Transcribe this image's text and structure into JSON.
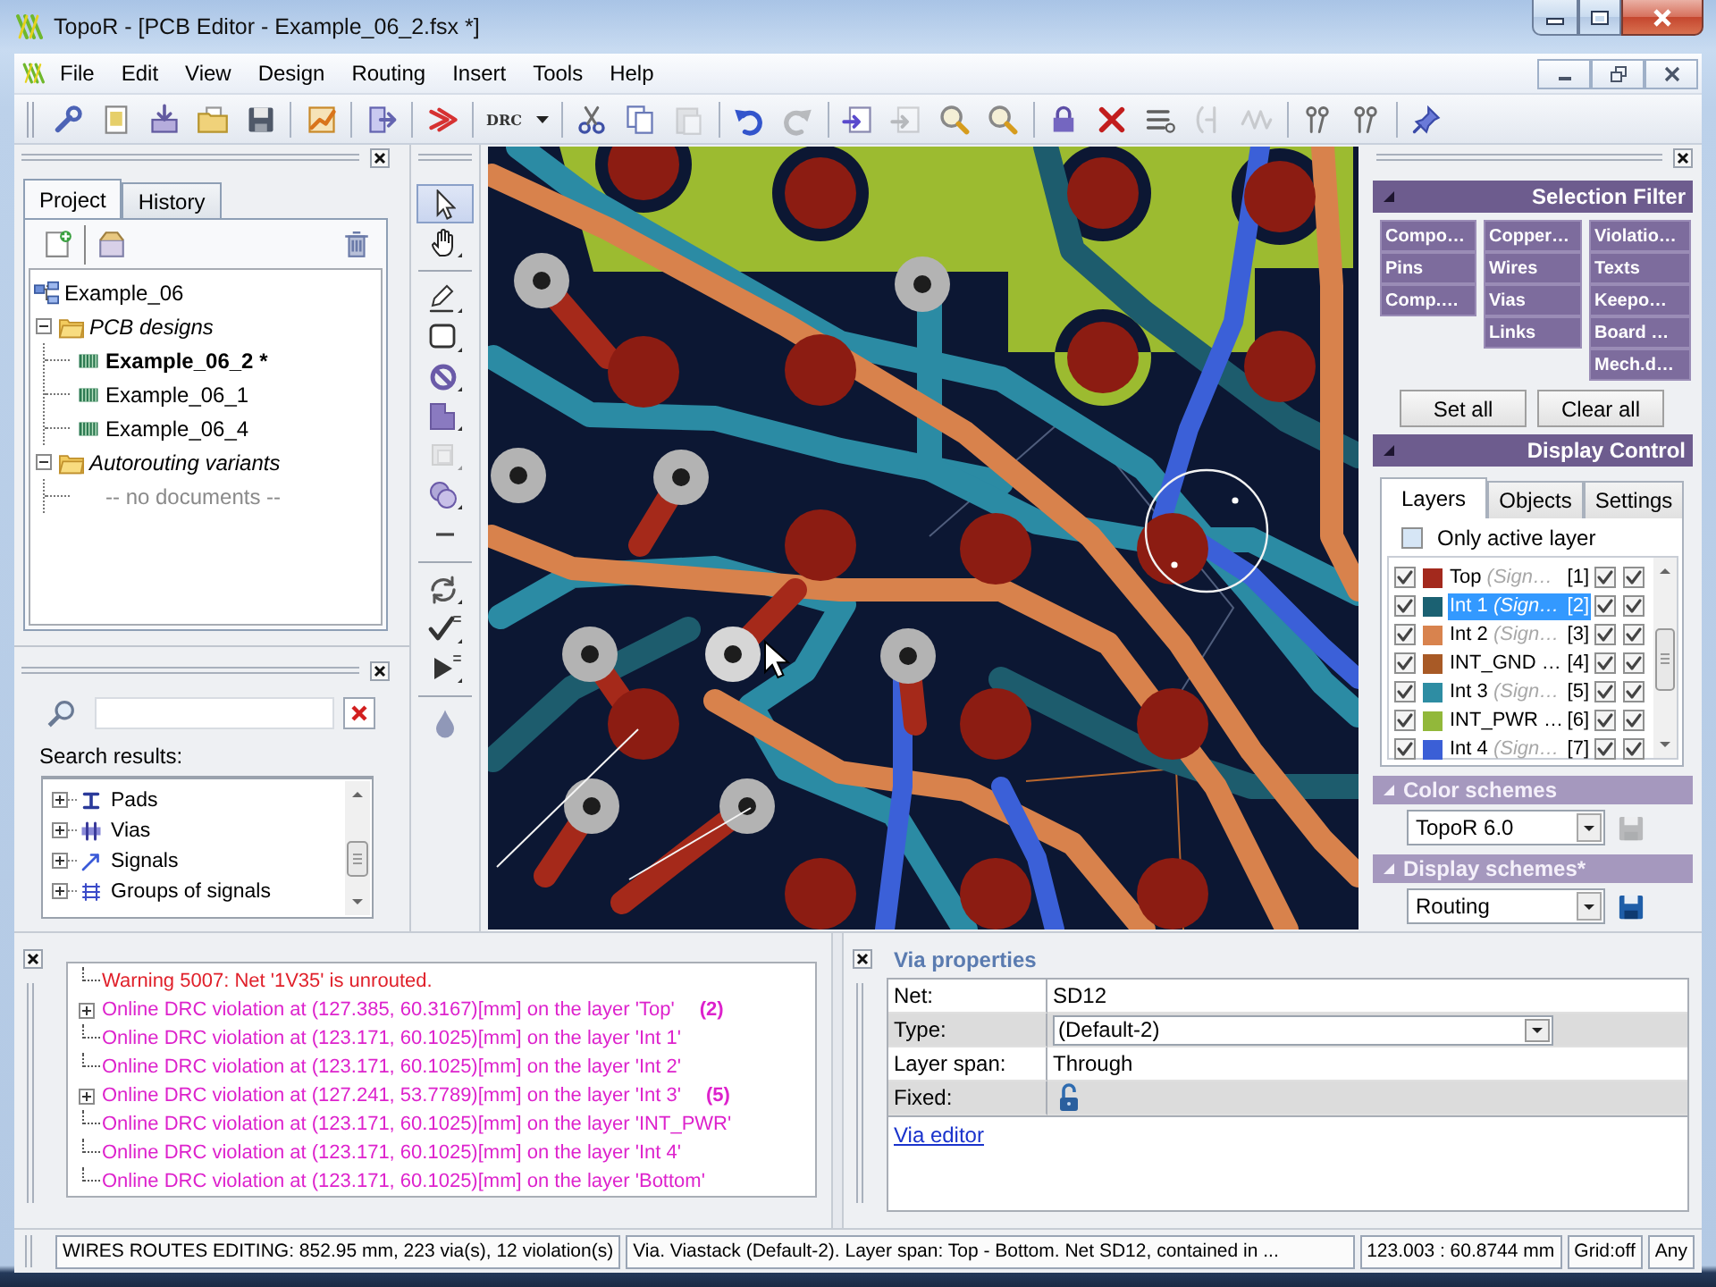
{
  "window": {
    "title": "TopoR - [PCB Editor - Example_06_2.fsx *]"
  },
  "menu": [
    "File",
    "Edit",
    "View",
    "Design",
    "Routing",
    "Insert",
    "Tools",
    "Help"
  ],
  "toolbar": [
    {
      "kind": "icon",
      "disabled": false
    },
    {
      "kind": "icon",
      "disabled": false
    },
    {
      "kind": "icon",
      "disabled": false
    },
    {
      "kind": "icon",
      "disabled": false
    },
    {
      "kind": "icon",
      "disabled": false
    },
    {
      "kind": "separator"
    },
    {
      "kind": "icon",
      "disabled": false
    },
    {
      "kind": "separator"
    },
    {
      "kind": "icon",
      "disabled": false
    },
    {
      "kind": "separator"
    },
    {
      "kind": "icon",
      "disabled": false
    },
    {
      "kind": "separator"
    },
    {
      "kind": "dropdown",
      "label": "DRC"
    },
    {
      "kind": "separator"
    },
    {
      "kind": "icon",
      "disabled": false
    },
    {
      "kind": "icon",
      "disabled": false
    },
    {
      "kind": "icon",
      "disabled": true
    },
    {
      "kind": "separator"
    },
    {
      "kind": "icon",
      "disabled": false
    },
    {
      "kind": "icon",
      "disabled": true
    },
    {
      "kind": "separator"
    },
    {
      "kind": "icon",
      "disabled": false
    },
    {
      "kind": "icon",
      "disabled": true
    },
    {
      "kind": "icon",
      "disabled": false
    },
    {
      "kind": "icon",
      "disabled": false
    },
    {
      "kind": "separator"
    },
    {
      "kind": "icon",
      "disabled": false
    },
    {
      "kind": "icon",
      "disabled": false
    },
    {
      "kind": "icon",
      "disabled": false
    },
    {
      "kind": "icon",
      "disabled": true
    },
    {
      "kind": "icon",
      "disabled": true
    },
    {
      "kind": "separator"
    },
    {
      "kind": "icon",
      "disabled": false
    },
    {
      "kind": "icon",
      "disabled": false
    },
    {
      "kind": "separator"
    },
    {
      "kind": "icon",
      "disabled": false
    }
  ],
  "project_panel": {
    "tabs": [
      {
        "label": "Project",
        "selected": true
      },
      {
        "label": "History",
        "selected": false
      }
    ],
    "tree": [
      {
        "label": "Example_06",
        "kind": "project",
        "children": [
          {
            "label": "PCB designs",
            "kind": "folder",
            "expanded": true,
            "children": [
              {
                "label": "Example_06_2 *",
                "kind": "design",
                "active": true
              },
              {
                "label": "Example_06_1",
                "kind": "design",
                "active": false
              },
              {
                "label": "Example_06_4",
                "kind": "design",
                "active": false
              }
            ]
          },
          {
            "label": "Autorouting variants",
            "kind": "folder",
            "expanded": true,
            "children": [
              {
                "label": "-- no documents --",
                "kind": "empty"
              }
            ]
          }
        ]
      }
    ]
  },
  "search_panel": {
    "results_label": "Search results:",
    "results": [
      {
        "label": "Pads",
        "expanded": false
      },
      {
        "label": "Vias",
        "expanded": false
      },
      {
        "label": "Signals",
        "expanded": false
      },
      {
        "label": "Groups of signals",
        "expanded": false
      }
    ]
  },
  "tool_strip": [
    {
      "kind": "tool",
      "selected": true,
      "disabled": false
    },
    {
      "kind": "tool",
      "selected": false,
      "disabled": false
    },
    {
      "kind": "separator"
    },
    {
      "kind": "tool",
      "selected": false,
      "disabled": false
    },
    {
      "kind": "tool",
      "selected": false,
      "disabled": false
    },
    {
      "kind": "tool",
      "selected": false,
      "disabled": false
    },
    {
      "kind": "tool",
      "selected": false,
      "disabled": false
    },
    {
      "kind": "tool",
      "selected": false,
      "disabled": true
    },
    {
      "kind": "tool",
      "selected": false,
      "disabled": false
    },
    {
      "kind": "tool",
      "selected": false,
      "disabled": false
    },
    {
      "kind": "separator"
    },
    {
      "kind": "tool",
      "selected": false,
      "disabled": false
    },
    {
      "kind": "tool",
      "selected": false,
      "disabled": false
    },
    {
      "kind": "tool",
      "selected": false,
      "disabled": false
    },
    {
      "kind": "separator"
    },
    {
      "kind": "tool",
      "selected": false,
      "disabled": false
    }
  ],
  "selection_filter": {
    "title": "Selection Filter",
    "columns": [
      [
        "Compo…",
        "Pins",
        "Comp.…"
      ],
      [
        "Copper…",
        "Wires",
        "Vias",
        "Links"
      ],
      [
        "Violatio…",
        "Texts",
        "Keepo…",
        "Board …",
        "Mech.d…"
      ]
    ],
    "buttons": [
      "Set all",
      "Clear all"
    ]
  },
  "display_control": {
    "title": "Display Control",
    "tabs": [
      {
        "label": "Layers",
        "selected": true
      },
      {
        "label": "Objects",
        "selected": false
      },
      {
        "label": "Settings",
        "selected": false
      }
    ],
    "only_active_layer": {
      "label": "Only active layer",
      "checked": false
    },
    "layers": [
      {
        "name": "Top",
        "note": "(Sign…",
        "index": "[1]",
        "color": "#a3291d",
        "checked": [
          true,
          true,
          true
        ],
        "selected": false
      },
      {
        "name": "Int 1",
        "note": "(Sign…",
        "index": "[2]",
        "color": "#1b6172",
        "checked": [
          true,
          true,
          true
        ],
        "selected": true
      },
      {
        "name": "Int 2",
        "note": "(Sign…",
        "index": "[3]",
        "color": "#d8834e",
        "checked": [
          true,
          true,
          true
        ],
        "selected": false
      },
      {
        "name": "INT_GND …",
        "index": "[4]",
        "color": "#a85a26",
        "checked": [
          true,
          true,
          true
        ],
        "selected": false
      },
      {
        "name": "Int 3",
        "note": "(Sign…",
        "index": "[5]",
        "color": "#2e8da3",
        "checked": [
          true,
          true,
          true
        ],
        "selected": false
      },
      {
        "name": "INT_PWR …",
        "index": "[6]",
        "color": "#92b83a",
        "checked": [
          true,
          true,
          true
        ],
        "selected": false
      },
      {
        "name": "Int 4",
        "note": "(Sign…",
        "index": "[7]",
        "color": "#3b5fd6",
        "checked": [
          true,
          true,
          true
        ],
        "selected": false
      }
    ]
  },
  "color_schemes": {
    "title": "Color schemes",
    "value": "TopoR 6.0",
    "save_disabled": true
  },
  "display_schemes": {
    "title": "Display schemes*",
    "value": "Routing",
    "save_disabled": false
  },
  "log": [
    {
      "kind": "warning",
      "text": "Warning 5007: Net '1V35' is unrouted."
    },
    {
      "kind": "group",
      "text": "Online DRC violation at (127.385, 60.3167)[mm] on the layer 'Top'",
      "count": "(2)",
      "expanded": false
    },
    {
      "kind": "violation",
      "text": "Online DRC violation at (123.171, 60.1025)[mm] on the layer 'Int 1'"
    },
    {
      "kind": "violation",
      "text": "Online DRC violation at (123.171, 60.1025)[mm] on the layer 'Int 2'"
    },
    {
      "kind": "group",
      "text": "Online DRC violation at (127.241, 53.7789)[mm] on the layer 'Int 3'",
      "count": "(5)",
      "expanded": false
    },
    {
      "kind": "violation",
      "text": "Online DRC violation at (123.171, 60.1025)[mm] on the layer 'INT_PWR'"
    },
    {
      "kind": "violation",
      "text": "Online DRC violation at (123.171, 60.1025)[mm] on the layer 'Int 4'"
    },
    {
      "kind": "violation",
      "text": "Online DRC violation at (123.171, 60.1025)[mm] on the layer 'Bottom'"
    }
  ],
  "via_properties": {
    "title": "Via properties",
    "rows": [
      {
        "label": "Net:",
        "kind": "text",
        "value": "SD12"
      },
      {
        "label": "Type:",
        "kind": "dropdown",
        "value": "(Default-2)"
      },
      {
        "label": "Layer span:",
        "kind": "text",
        "value": "Through"
      },
      {
        "label": "Fixed:",
        "kind": "lock",
        "locked": false
      }
    ],
    "link": "Via editor"
  },
  "status_bar": [
    "WIRES ROUTES EDITING: 852.95 mm, 223 via(s), 12 violation(s)",
    "Via. Viastack (Default-2). Layer span: Top - Bottom. Net SD12, contained in ...",
    "123.003 : 60.8744 mm",
    "Grid:off",
    "Any"
  ]
}
